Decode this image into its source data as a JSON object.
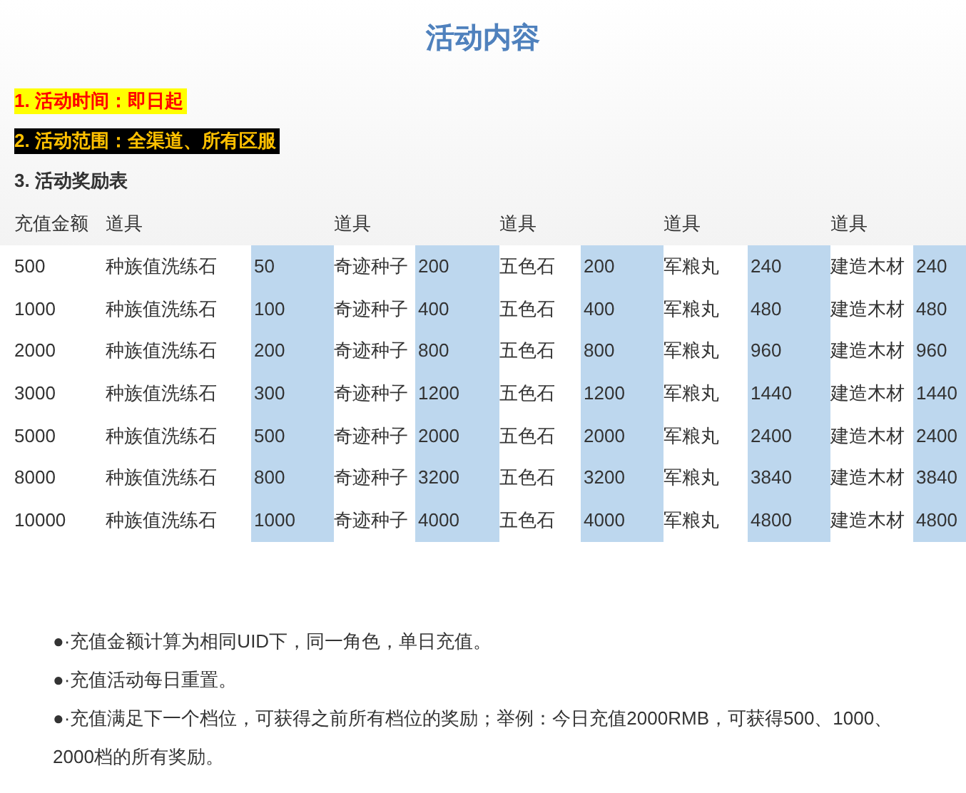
{
  "title": "活动内容",
  "info": [
    "1. 活动时间：即日起",
    "2. 活动范围：全渠道、所有区服",
    "3. 活动奖励表"
  ],
  "table": {
    "columns": [
      "充值金额",
      "道具",
      "道具",
      "道具",
      "道具",
      "道具"
    ],
    "rows": [
      {
        "amount": "500",
        "items": [
          {
            "name": "种族值洗练石",
            "qty": "50"
          },
          {
            "name": "奇迹种子",
            "qty": "200"
          },
          {
            "name": "五色石",
            "qty": "200"
          },
          {
            "name": "军粮丸",
            "qty": "240"
          },
          {
            "name": "建造木材",
            "qty": "240"
          }
        ]
      },
      {
        "amount": "1000",
        "items": [
          {
            "name": "种族值洗练石",
            "qty": "100"
          },
          {
            "name": "奇迹种子",
            "qty": "400"
          },
          {
            "name": "五色石",
            "qty": "400"
          },
          {
            "name": "军粮丸",
            "qty": "480"
          },
          {
            "name": "建造木材",
            "qty": "480"
          }
        ]
      },
      {
        "amount": "2000",
        "items": [
          {
            "name": "种族值洗练石",
            "qty": "200"
          },
          {
            "name": "奇迹种子",
            "qty": "800"
          },
          {
            "name": "五色石",
            "qty": "800"
          },
          {
            "name": "军粮丸",
            "qty": "960"
          },
          {
            "name": "建造木材",
            "qty": "960"
          }
        ]
      },
      {
        "amount": "3000",
        "items": [
          {
            "name": "种族值洗练石",
            "qty": "300"
          },
          {
            "name": "奇迹种子",
            "qty": "1200"
          },
          {
            "name": "五色石",
            "qty": "1200"
          },
          {
            "name": "军粮丸",
            "qty": "1440"
          },
          {
            "name": "建造木材",
            "qty": "1440"
          }
        ]
      },
      {
        "amount": "5000",
        "items": [
          {
            "name": "种族值洗练石",
            "qty": "500"
          },
          {
            "name": "奇迹种子",
            "qty": "2000"
          },
          {
            "name": "五色石",
            "qty": "2000"
          },
          {
            "name": "军粮丸",
            "qty": "2400"
          },
          {
            "name": "建造木材",
            "qty": "2400"
          }
        ]
      },
      {
        "amount": "8000",
        "items": [
          {
            "name": "种族值洗练石",
            "qty": "800"
          },
          {
            "name": "奇迹种子",
            "qty": "3200"
          },
          {
            "name": "五色石",
            "qty": "3200"
          },
          {
            "name": "军粮丸",
            "qty": "3840"
          },
          {
            "name": "建造木材",
            "qty": "3840"
          }
        ]
      },
      {
        "amount": "10000",
        "items": [
          {
            "name": "种族值洗练石",
            "qty": "1000"
          },
          {
            "name": "奇迹种子",
            "qty": "4000"
          },
          {
            "name": "五色石",
            "qty": "4000"
          },
          {
            "name": "军粮丸",
            "qty": "4800"
          },
          {
            "name": "建造木材",
            "qty": "4800"
          }
        ]
      }
    ]
  },
  "notes": [
    "●·充值金额计算为相同UID下，同一角色，单日充值。",
    "●·充值活动每日重置。",
    "●·充值满足下一个档位，可获得之前所有档位的奖励；举例：今日充值2000RMB，可获得500、1000、2000档的所有奖励。"
  ]
}
